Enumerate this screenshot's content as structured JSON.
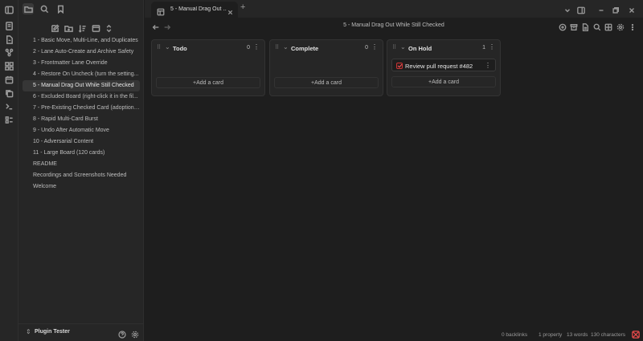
{
  "window": {
    "tab_title": "5 - Manual Drag Out ...",
    "new_tab_symbol": "+",
    "view_title": "5 - Manual Drag Out While Still Checked"
  },
  "sidebar": {
    "files": [
      "1 - Basic Move, Multi-Line, and Duplicates",
      "2 - Lane Auto-Create and Archive Safety",
      "3 - Frontmatter Lane Override",
      "4 - Restore On Uncheck (turn the setting...",
      "5 - Manual Drag Out While Still Checked",
      "6 - Excluded Board (right-click it in the fil...",
      "7 - Pre-Existing Checked Card (adoption ...",
      "8 - Rapid Multi-Card Burst",
      "9 - Undo After Automatic Move",
      "10 - Adversarial Content",
      "11 - Large Board (120 cards)",
      "README",
      "Recordings and Screenshots Needed",
      "Welcome"
    ],
    "active_index": 4,
    "vault_name": "Plugin Tester"
  },
  "board": {
    "lanes": [
      {
        "title": "Todo",
        "count": "0",
        "cards": [],
        "add_label": "+Add a card"
      },
      {
        "title": "Complete",
        "count": "0",
        "cards": [],
        "add_label": "+Add a card"
      },
      {
        "title": "On Hold",
        "count": "1",
        "cards": [
          "Review pull request #482"
        ],
        "add_label": "+Add a card"
      }
    ]
  },
  "status": {
    "backlinks": "0 backlinks",
    "properties": "1 property",
    "words": "13 words",
    "characters": "130 characters"
  }
}
